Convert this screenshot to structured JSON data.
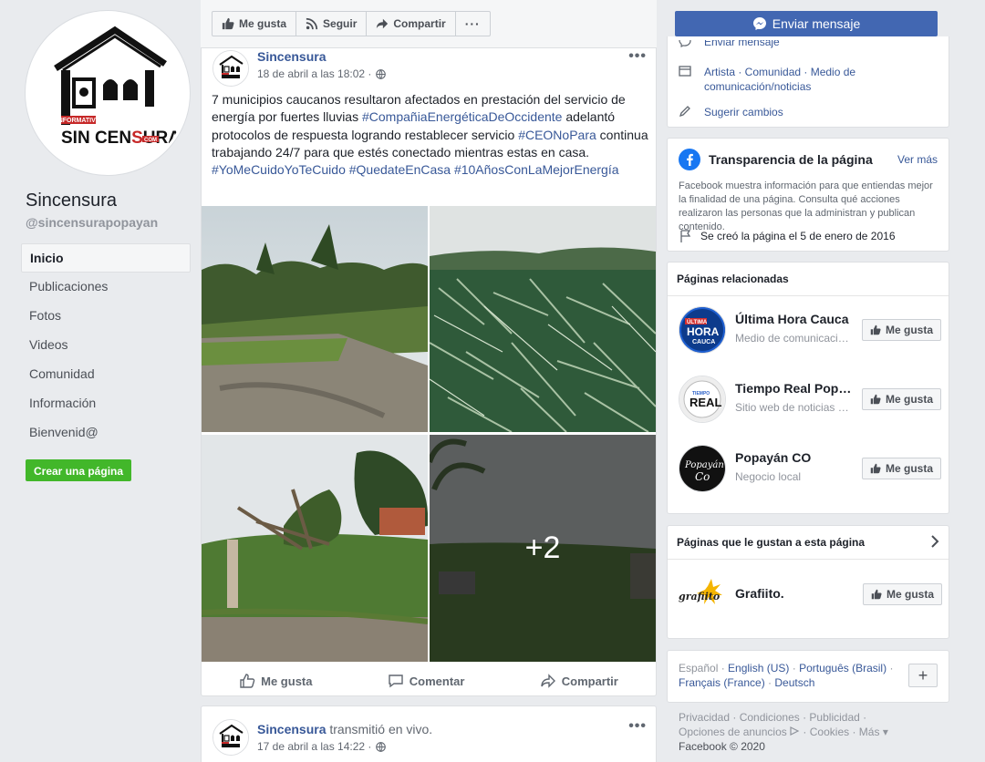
{
  "page": {
    "name": "Sincensura",
    "handle": "@sincensurapopayan",
    "logo_text": "INFORMATIVO SIN CENSURA.COM"
  },
  "nav": {
    "items": [
      "Inicio",
      "Publicaciones",
      "Fotos",
      "Videos",
      "Comunidad",
      "Información",
      "Bienvenid@"
    ],
    "active_index": 0,
    "create_page": "Crear una página"
  },
  "topbar": {
    "like": "Me gusta",
    "follow": "Seguir",
    "share": "Compartir",
    "more": "···"
  },
  "message_button": "Enviar mensaje",
  "about": {
    "send_message_partial": "Enviar mensaje",
    "categories_line1": "Artista · Comunidad · Medio de",
    "categories_line2": "comunicación/noticias",
    "suggest": "Sugerir cambios"
  },
  "post": {
    "author": "Sincensura",
    "date": "18 de abril a las 18:02 ·",
    "text_plain1": "7 municipios caucanos resultaron afectados en prestación del servicio de energía por fuertes lluvias ",
    "tag1": "#CompañiaEnergéticaDeOccidente",
    "text_plain2": " adelantó protocolos de respuesta logrando restablecer servicio ",
    "tag2": "#CEONoPara",
    "text_plain3": " continua trabajando 24/7 para que estés conectado mientras estas en casa. ",
    "tag3": "#YoMeCuidoYoTeCuido",
    "tag4": "#QuedateEnCasa",
    "tag5": "#10AñosConLaMejorEnergía",
    "more_photos": "+2",
    "actions": {
      "like": "Me gusta",
      "comment": "Comentar",
      "share": "Compartir"
    }
  },
  "post2": {
    "author": "Sincensura",
    "live": " transmitió en vivo.",
    "date": "17 de abril a las 14:22 ·"
  },
  "transparency": {
    "title": "Transparencia de la página",
    "more": "Ver más",
    "desc": "Facebook muestra información para que entiendas mejor la finalidad de una página. Consulta qué acciones realizaron las personas que la administran y publican contenido.",
    "created": "Se creó la página el 5 de enero de 2016"
  },
  "related": {
    "title": "Páginas relacionadas",
    "like": "Me gusta",
    "items": [
      {
        "name": "Última Hora Cauca",
        "sub": "Medio de comunicación/noticias",
        "logo": "ÚLTIMA HORA CAUCA"
      },
      {
        "name": "Tiempo Real Popayán",
        "sub": "Sitio web de noticias y medios",
        "logo": "TIEMPO REAL"
      },
      {
        "name": "Popayán CO",
        "sub": "Negocio local",
        "logo": "Popayán Co"
      }
    ]
  },
  "liked": {
    "title": "Páginas que le gustan a esta página",
    "item": "Grafiito.",
    "logo": "grafiito",
    "like": "Me gusta"
  },
  "languages": {
    "current": "Español · ",
    "list": [
      "English (US)",
      "Português (Brasil)",
      "Français (France)",
      "Deutsch"
    ],
    "plus": "+"
  },
  "footer": {
    "links": [
      "Privacidad",
      "Condiciones",
      "Publicidad",
      "Opciones de anuncios",
      "Cookies",
      "Más"
    ],
    "copyright": "Facebook © 2020"
  }
}
